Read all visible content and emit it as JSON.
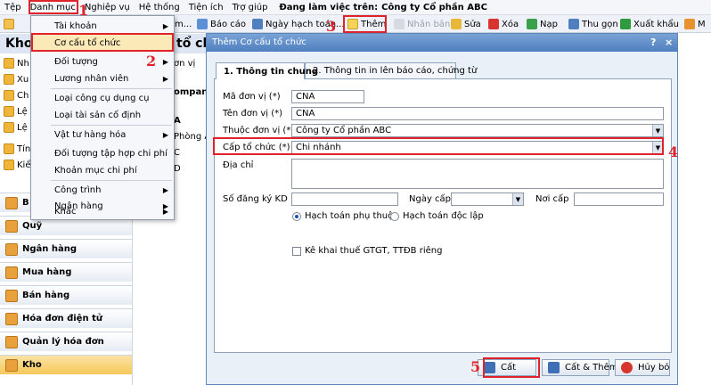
{
  "menubar": {
    "items": [
      "Tệp",
      "Danh mục",
      "Nghiệp vụ",
      "Hệ thống",
      "Tiện ích",
      "Trợ giúp"
    ],
    "company_label": "Đang làm việc trên:",
    "company_name": "Công ty Cổ phần ABC"
  },
  "toolbar": {
    "items": [
      {
        "label": "",
        "icon": "folder-icon"
      },
      {
        "label": "m...",
        "icon": "document-icon"
      },
      {
        "label": "Báo cáo",
        "icon": "report-icon"
      },
      {
        "label": "Ngày hạch toán...",
        "icon": "calendar-icon"
      },
      {
        "label": "Thêm",
        "icon": "add-icon"
      },
      {
        "label": "Nhân bản",
        "icon": "duplicate-icon"
      },
      {
        "label": "Sửa",
        "icon": "edit-icon"
      },
      {
        "label": "Xóa",
        "icon": "delete-icon"
      },
      {
        "label": "Nạp",
        "icon": "refresh-icon"
      },
      {
        "label": "Thu gọn",
        "icon": "collapse-icon"
      },
      {
        "label": "Xuất khẩu",
        "icon": "excel-icon"
      },
      {
        "label": "M",
        "icon": "mail-icon"
      }
    ]
  },
  "left_pane": {
    "title": "Kho",
    "title_tail": "tổ chứ",
    "items": [
      "Nh",
      "Xu",
      "Ch",
      "Lệ",
      "Lệ",
      "Tín",
      "Kiể"
    ],
    "nav": [
      {
        "label": "B",
        "icon": "cash-icon"
      },
      {
        "label": "Quỹ",
        "icon": "safe-icon"
      },
      {
        "label": "Ngân hàng",
        "icon": "bank-icon"
      },
      {
        "label": "Mua hàng",
        "icon": "cart-icon"
      },
      {
        "label": "Bán hàng",
        "icon": "sales-icon"
      },
      {
        "label": "Hóa đơn điện tử",
        "icon": "invoice-icon"
      },
      {
        "label": "Quản lý hóa đơn",
        "icon": "invoice-manage-icon"
      },
      {
        "label": "Kho",
        "icon": "warehouse-icon"
      }
    ],
    "grid_header": "ơn vị",
    "grid_rows": [
      "ompany",
      "A",
      "Phòng A",
      "C",
      "D"
    ]
  },
  "dropdown": {
    "items": [
      {
        "label": "Tài khoản",
        "submenu": true
      },
      {
        "label": "Cơ cấu tổ chức",
        "submenu": false
      },
      {
        "label": "Đối tượng",
        "submenu": true
      },
      {
        "label": "Lương nhân viên",
        "submenu": true
      },
      {
        "label": "Loại công cụ dụng cụ",
        "submenu": false
      },
      {
        "label": "Loại tài sản cố định",
        "submenu": false
      },
      {
        "label": "Vật tư hàng hóa",
        "submenu": true
      },
      {
        "label": "Đối tượng tập hợp chi phí",
        "submenu": false
      },
      {
        "label": "Khoản mục chi phí",
        "submenu": false
      },
      {
        "label": "Công trình",
        "submenu": true
      },
      {
        "label": "Ngân hàng",
        "submenu": true
      },
      {
        "label": "Khác",
        "submenu": true
      }
    ]
  },
  "dialog": {
    "title": "Thêm Cơ cấu tổ chức",
    "help": "?",
    "close": "×",
    "tabs": [
      "1. Thông tin chung",
      "2. Thông tin in lên báo cáo, chứng từ"
    ],
    "fields": {
      "ma_don_vi": {
        "label": "Mã đơn vị (*)",
        "value": "CNA"
      },
      "ten_don_vi": {
        "label": "Tên đơn vị (*)",
        "value": "CNA"
      },
      "thuoc_don_vi": {
        "label": "Thuộc đơn vị (*)",
        "value": "Công ty Cổ phần ABC"
      },
      "cap_to_chuc": {
        "label": "Cấp tổ chức (*)",
        "value": "Chi nhánh"
      },
      "dia_chi": {
        "label": "Địa chỉ",
        "value": ""
      },
      "so_dang_ky": {
        "label": "Số đăng ký KD",
        "value": ""
      },
      "ngay_cap": {
        "label": "Ngày cấp",
        "value": ""
      },
      "noi_cap": {
        "label": "Nơi cấp",
        "value": ""
      }
    },
    "radios": [
      {
        "label": "Hạch toán phụ thuộc",
        "checked": true
      },
      {
        "label": "Hạch toán độc lập",
        "checked": false
      }
    ],
    "checkbox": {
      "label": "Kê khai thuế GTGT, TTĐB riêng",
      "checked": false
    },
    "buttons": {
      "save": "Cất",
      "save_add": "Cất & Thêm",
      "cancel": "Hủy bỏ"
    }
  },
  "annotations": {
    "n1": "1",
    "n2": "2",
    "n3": "3",
    "n4": "4",
    "n5": "5"
  },
  "colors": {
    "highlight": "#e0232b",
    "title_bar": "#4f7fbf",
    "active_nav": "#f6c85a"
  }
}
